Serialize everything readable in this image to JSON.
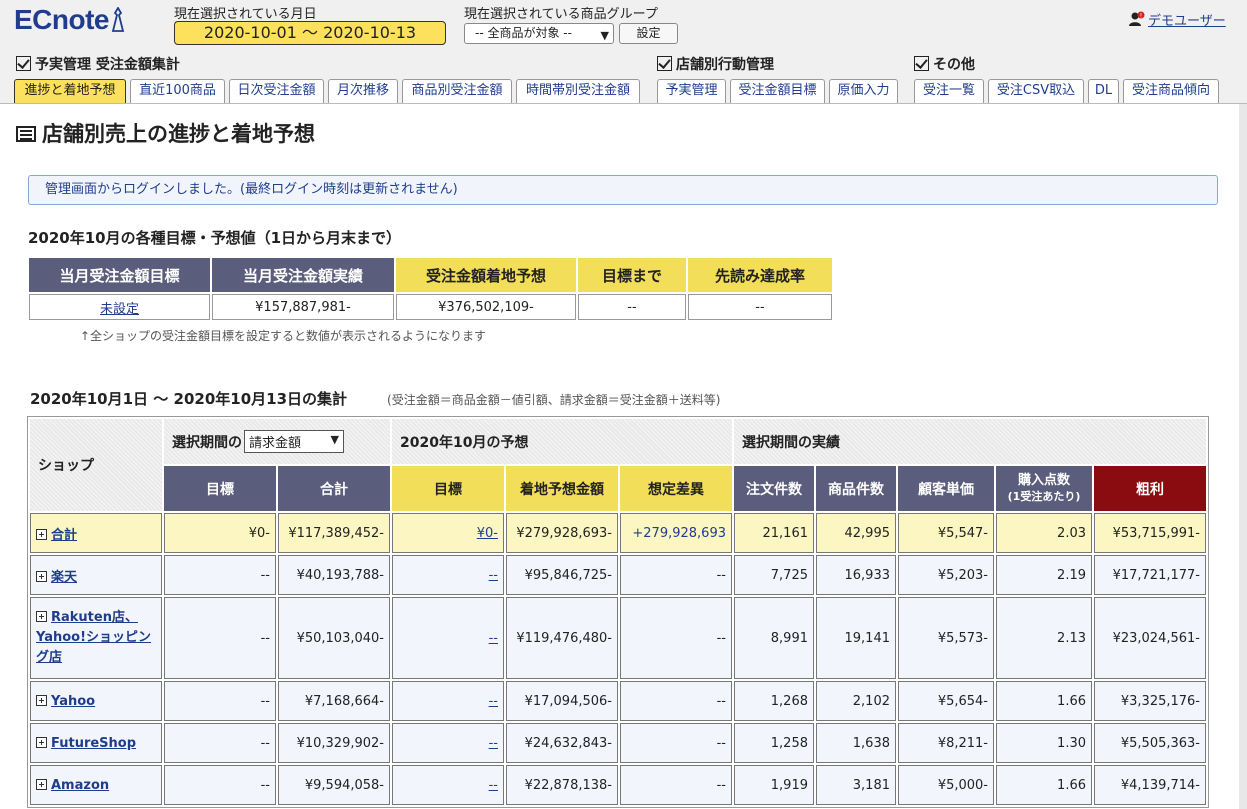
{
  "header": {
    "logo": "ECnote",
    "date_label": "現在選択されている月日",
    "date_range": "2020-10-01 〜 2020-10-13",
    "group_label": "現在選択されている商品グループ",
    "group_value": "-- 全商品が対象 --",
    "set_button": "設定",
    "user": "デモユーザー"
  },
  "sections": {
    "s1": "予実管理 受注金額集計",
    "s2": "店舗別行動管理",
    "s3": "その他"
  },
  "tabs": [
    "進捗と着地予想",
    "直近100商品",
    "日次受注金額",
    "月次推移",
    "商品別受注金額",
    "時間帯別受注金額",
    "予実管理",
    "受注金額目標",
    "原価入力",
    "受注一覧",
    "受注CSV取込",
    "DL",
    "受注商品傾向"
  ],
  "page": {
    "title": "店舗別売上の進捗と着地予想",
    "notice": "管理画面からログインしました。(最終ログイン時刻は更新されません)"
  },
  "targets": {
    "heading": "2020年10月の各種目標・予想値（1日から月末まで）",
    "headers": [
      "当月受注金額目標",
      "当月受注金額実績",
      "受注金額着地予想",
      "目標まで",
      "先読み達成率"
    ],
    "values": [
      "未設定",
      "¥157,887,981-",
      "¥376,502,109-",
      "--",
      "--"
    ],
    "note": "↑全ショップの受注金額目標を設定すると数値が表示されるようになります"
  },
  "summary": {
    "heading": "2020年10月1日 〜 2020年10月13日の集計",
    "formula": "(受注金額＝商品金額－値引額、請求金額＝受注金額＋送料等)",
    "shop_header": "ショップ",
    "period_label": "選択期間の",
    "period_select": "請求金額",
    "forecast_group": "2020年10月の予想",
    "actual_group": "選択期間の実績",
    "columns": [
      "目標",
      "合計",
      "目標",
      "着地予想金額",
      "想定差異",
      "注文件数",
      "商品件数",
      "顧客単価",
      "購入点数",
      "粗利"
    ],
    "columns_sub": "(1受注あたり)",
    "rows": [
      {
        "shop": "合計",
        "target": "¥0-",
        "total": "¥117,389,452-",
        "f_target": "¥0-",
        "forecast": "¥279,928,693-",
        "diff": "+279,928,693",
        "orders": "21,161",
        "items": "42,995",
        "unit": "¥5,547-",
        "points": "2.03",
        "profit": "¥53,715,991-"
      },
      {
        "shop": "楽天",
        "target": "--",
        "total": "¥40,193,788-",
        "f_target": "--",
        "forecast": "¥95,846,725-",
        "diff": "--",
        "orders": "7,725",
        "items": "16,933",
        "unit": "¥5,203-",
        "points": "2.19",
        "profit": "¥17,721,177-"
      },
      {
        "shop": "Rakuten店、Yahoo!ショッピング店",
        "target": "--",
        "total": "¥50,103,040-",
        "f_target": "--",
        "forecast": "¥119,476,480-",
        "diff": "--",
        "orders": "8,991",
        "items": "19,141",
        "unit": "¥5,573-",
        "points": "2.13",
        "profit": "¥23,024,561-"
      },
      {
        "shop": "Yahoo",
        "target": "--",
        "total": "¥7,168,664-",
        "f_target": "--",
        "forecast": "¥17,094,506-",
        "diff": "--",
        "orders": "1,268",
        "items": "2,102",
        "unit": "¥5,654-",
        "points": "1.66",
        "profit": "¥3,325,176-"
      },
      {
        "shop": "FutureShop",
        "target": "--",
        "total": "¥10,329,902-",
        "f_target": "--",
        "forecast": "¥24,632,843-",
        "diff": "--",
        "orders": "1,258",
        "items": "1,638",
        "unit": "¥8,211-",
        "points": "1.30",
        "profit": "¥5,505,363-"
      },
      {
        "shop": "Amazon",
        "target": "--",
        "total": "¥9,594,058-",
        "f_target": "--",
        "forecast": "¥22,878,138-",
        "diff": "--",
        "orders": "1,919",
        "items": "3,181",
        "unit": "¥5,000-",
        "points": "1.66",
        "profit": "¥4,139,714-"
      }
    ]
  }
}
